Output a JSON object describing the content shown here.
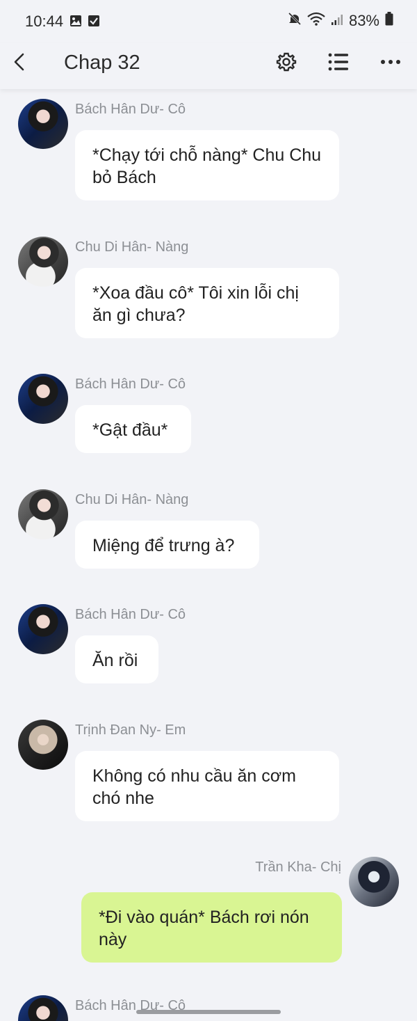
{
  "status_bar": {
    "time": "10:44",
    "battery": "83%",
    "left_icons": [
      "gallery-icon",
      "checkbox-icon"
    ],
    "right_icons": [
      "mute-icon",
      "wifi-icon",
      "signal-icon",
      "battery-icon"
    ]
  },
  "header": {
    "title": "Chap 32",
    "buttons": [
      "back-icon",
      "gear-icon",
      "list-icon",
      "more-icon"
    ]
  },
  "messages": [
    {
      "sender": "Bách Hân Dư- Cô",
      "text": "*Chạy tới chỗ nàng* Chu Chu bỏ Bách",
      "mine": false
    },
    {
      "sender": "Chu Di Hân- Nàng",
      "text": "*Xoa đầu cô* Tôi xin lỗi chị ăn gì chưa?",
      "mine": false
    },
    {
      "sender": "Bách Hân Dư- Cô",
      "text": "*Gật đầu*",
      "mine": false
    },
    {
      "sender": "Chu Di Hân- Nàng",
      "text": "Miệng để trưng à?",
      "mine": false
    },
    {
      "sender": "Bách Hân Dư- Cô",
      "text": "Ăn rồi",
      "mine": false
    },
    {
      "sender": "Trịnh Đan Ny- Em",
      "text": "Không có nhu cầu ăn cơm chó nhe",
      "mine": false
    },
    {
      "sender": "Trần Kha- Chị",
      "text": "*Đi vào quán* Bách rơi nón này",
      "mine": true
    },
    {
      "sender": "Bách Hân Dư- Cô",
      "text": "",
      "mine": false
    }
  ],
  "colors": {
    "background": "#f2f3f7",
    "bubble_other": "#ffffff",
    "bubble_mine": "#d9f593",
    "sender_text": "#8c8f94"
  }
}
